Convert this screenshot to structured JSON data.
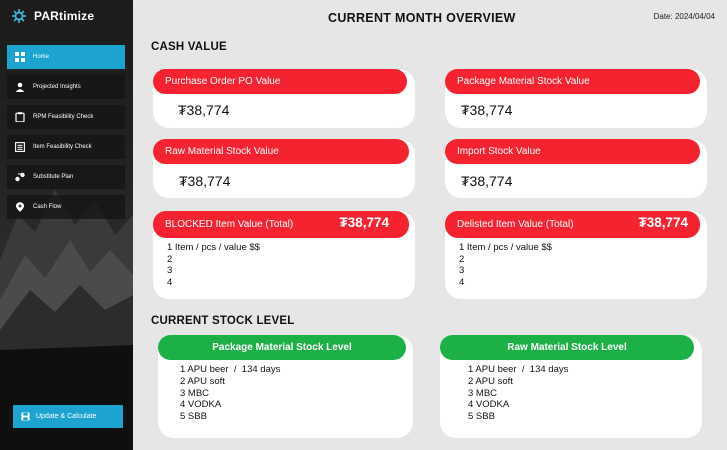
{
  "app": {
    "name": "PARtimize"
  },
  "sidebar": {
    "items": [
      {
        "label": "Home",
        "icon": "dashboard-icon",
        "active": true
      },
      {
        "label": "Projected Insights",
        "icon": "person-icon"
      },
      {
        "label": "RPM Feasibility Check",
        "icon": "clipboard-icon"
      },
      {
        "label": "Item Feasibility Check",
        "icon": "document-list-icon"
      },
      {
        "label": "Substitute Plan",
        "icon": "swap-icon"
      },
      {
        "label": "Cash Flow",
        "icon": "location-pin-icon"
      }
    ],
    "update_label": "Update & Calculate"
  },
  "header": {
    "title": "CURRENT MONTH OVERVIEW",
    "date": "Date: 2024/04/04"
  },
  "cash_value": {
    "title": "CASH VALUE",
    "cards": [
      {
        "label": "Purchase Order PO Value",
        "amount": "₮38,774"
      },
      {
        "label": "Package Material Stock Value",
        "amount": "₮38,774"
      },
      {
        "label": "Raw Material Stock Value",
        "amount": "₮38,774"
      },
      {
        "label": "Import Stock Value",
        "amount": "₮38,774"
      }
    ],
    "blocked": {
      "label": "BLOCKED Item Value (Total)",
      "amount": "₮38,774",
      "lines": [
        "1 Item / pcs / value $$",
        "2",
        "3",
        "4"
      ]
    },
    "delisted": {
      "label": "Delisted Item Value (Total)",
      "amount": "₮38,774",
      "lines": [
        "1 Item / pcs / value $$",
        "2",
        "3",
        "4"
      ]
    }
  },
  "stock_level": {
    "title": "CURRENT STOCK LEVEL",
    "package": {
      "label": "Package Material Stock Level",
      "lines": [
        "1 APU beer  /  134 days",
        "2 APU soft",
        "3 MBC",
        "4 VODKA",
        "5 SBB"
      ]
    },
    "raw": {
      "label": "Raw Material Stock Level",
      "lines": [
        "1 APU beer  /  134 days",
        "2 APU soft",
        "3 MBC",
        "4 VODKA",
        "5 SBB"
      ]
    }
  }
}
